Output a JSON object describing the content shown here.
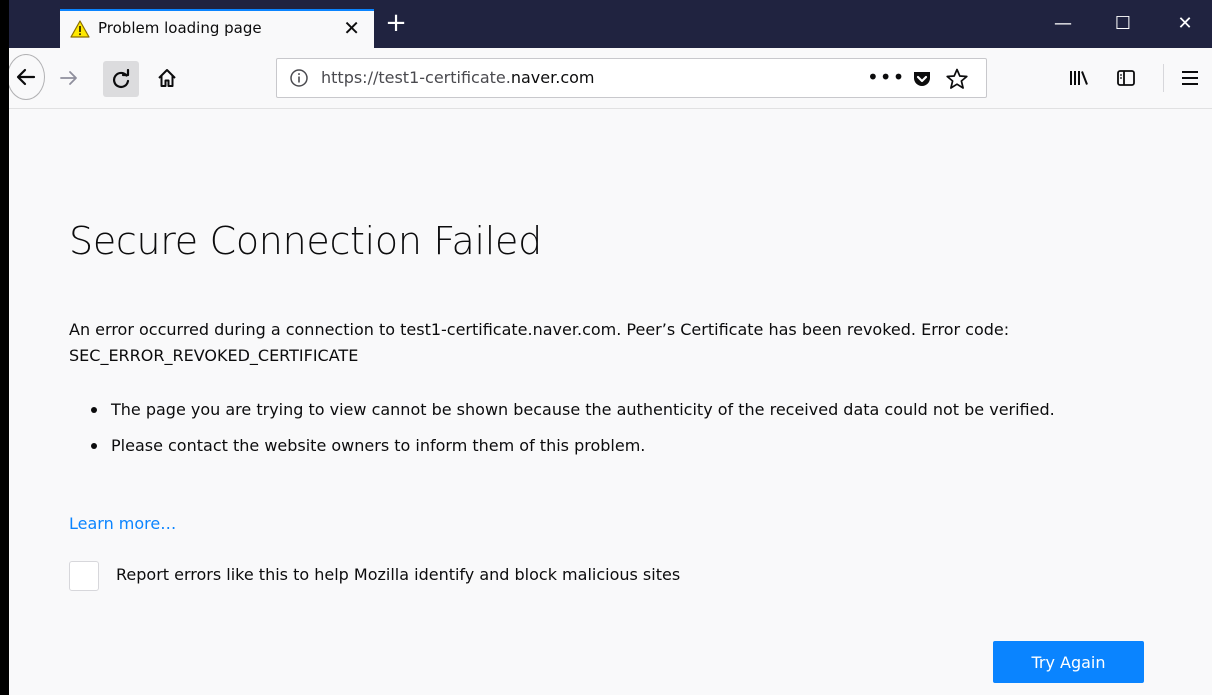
{
  "browser": {
    "tab": {
      "title": "Problem loading page",
      "icon": "warning-icon",
      "close_glyph": "✕"
    },
    "new_tab_glyph": "+",
    "window_controls": {
      "minimize": "—",
      "maximize": "☐",
      "close": "✕"
    },
    "address_bar": {
      "url_prefix": "https://test1-certificate.",
      "url_domain": "naver.com",
      "more_glyph": "•••"
    }
  },
  "page": {
    "title": "Secure Connection Failed",
    "description": "An error occurred during a connection to test1-certificate.naver.com. Peer’s Certificate has been revoked. Error code: SEC_ERROR_REVOKED_CERTIFICATE",
    "reasons": [
      "The page you are trying to view cannot be shown because the authenticity of the received data could not be verified.",
      "Please contact the website owners to inform them of this problem."
    ],
    "learn_more": "Learn more…",
    "report_checkbox": {
      "checked": false,
      "label": "Report errors like this to help Mozilla identify and block malicious sites"
    },
    "try_again": "Try Again"
  },
  "colors": {
    "tabbar": "#202340",
    "accent": "#0a84ff",
    "background": "#f9f9fa",
    "text": "#0c0c0d"
  }
}
